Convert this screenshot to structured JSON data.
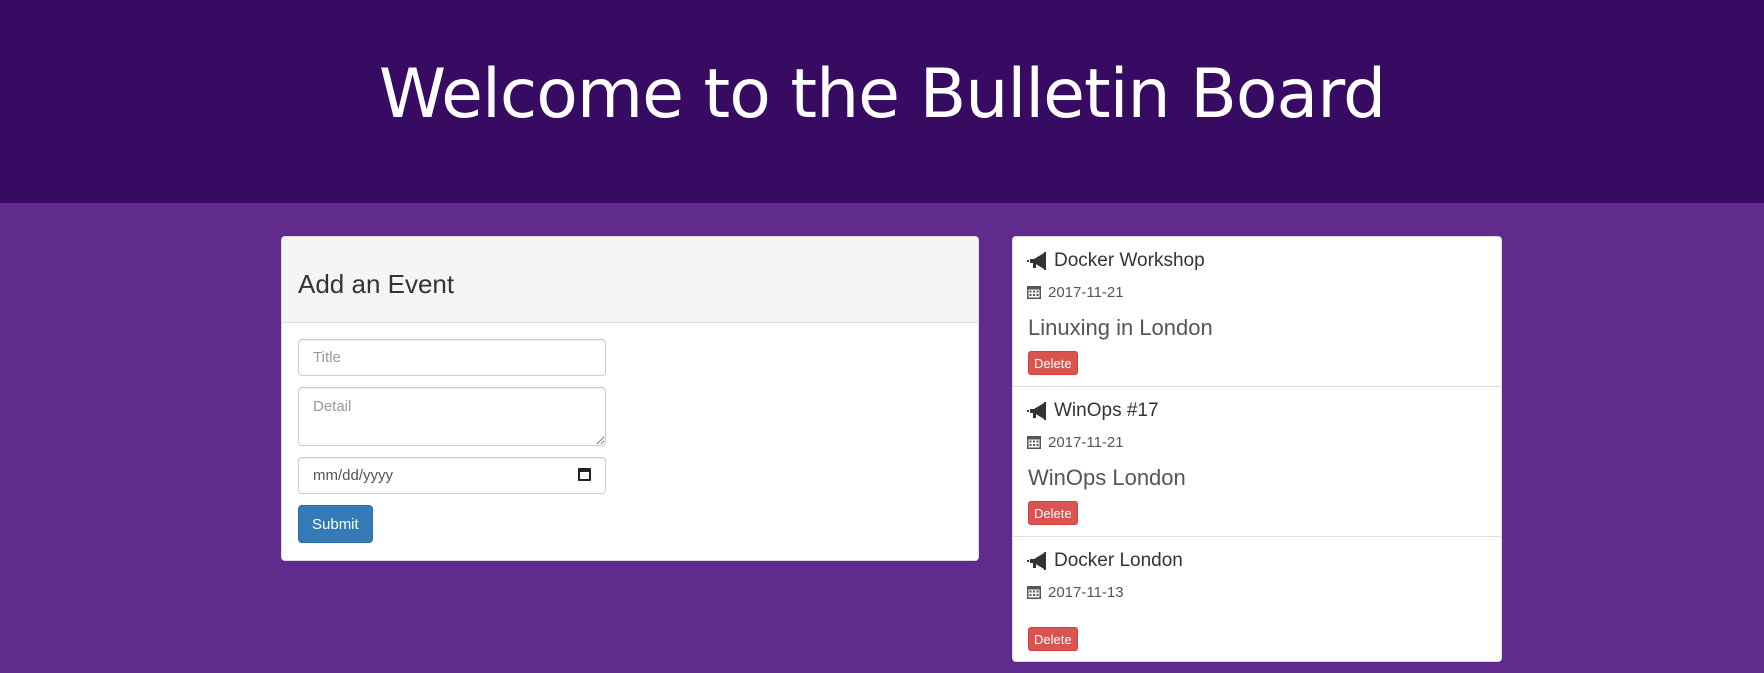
{
  "header": {
    "title": "Welcome to the Bulletin Board"
  },
  "form": {
    "heading": "Add an Event",
    "title_placeholder": "Title",
    "detail_placeholder": "Detail",
    "date_placeholder": "mm/dd/yyyy",
    "submit_label": "Submit"
  },
  "events": [
    {
      "title": "Docker Workshop",
      "date": "2017-11-21",
      "detail": "Linuxing in London",
      "delete_label": "Delete"
    },
    {
      "title": "WinOps #17",
      "date": "2017-11-21",
      "detail": "WinOps London",
      "delete_label": "Delete"
    },
    {
      "title": "Docker London",
      "date": "2017-11-13",
      "detail": "",
      "delete_label": "Delete"
    }
  ],
  "colors": {
    "header_bg": "#380b63",
    "page_bg": "#612a8d",
    "primary": "#337ab7",
    "danger": "#d9534f"
  },
  "icons": {
    "event_title": "bullhorn-icon",
    "event_date": "calendar-icon",
    "date_input": "calendar-icon"
  }
}
